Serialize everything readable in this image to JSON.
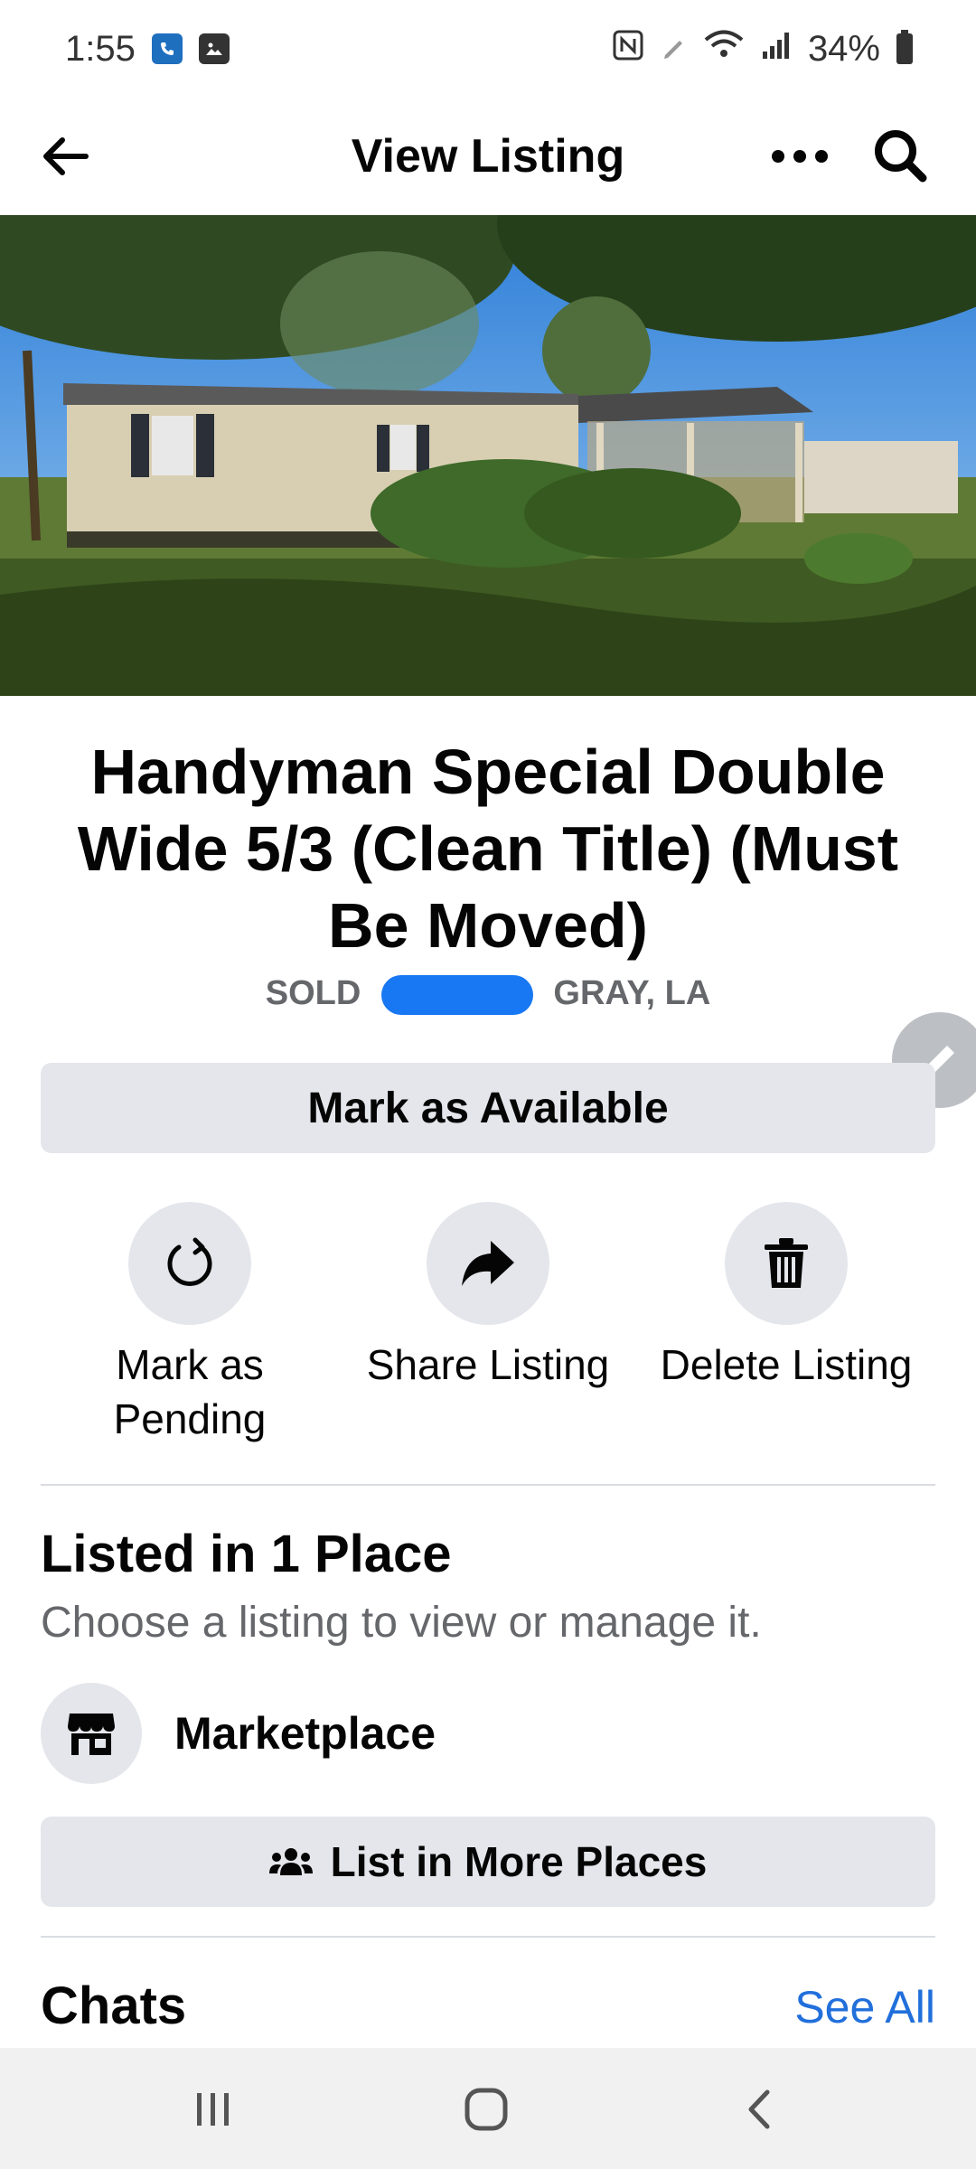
{
  "status_bar": {
    "time": "1:55",
    "battery": "34%",
    "icons": [
      "phone-app-icon",
      "gallery-icon",
      "nfc-icon",
      "pen-icon",
      "wifi-icon",
      "signal-icon",
      "battery-icon"
    ]
  },
  "app_bar": {
    "title": "View Listing",
    "icons": [
      "arrow-left-icon",
      "more-horizontal-icon",
      "search-icon"
    ]
  },
  "listing": {
    "title": "Handyman Special Double Wide 5/3 (Clean Title) (Must Be Moved)",
    "status": "SOLD",
    "location": "GRAY, LA",
    "primary_action": "Mark as Available"
  },
  "actions": [
    {
      "label": "Mark as Pending",
      "icon": "refresh-icon"
    },
    {
      "label": "Share Listing",
      "icon": "share-icon"
    },
    {
      "label": "Delete Listing",
      "icon": "trash-icon"
    }
  ],
  "places": {
    "title": "Listed in 1 Place",
    "subtitle": "Choose a listing to view or manage it.",
    "items": [
      {
        "label": "Marketplace",
        "icon": "storefront-icon"
      }
    ],
    "button": "List in More Places",
    "button_icon": "people-icon"
  },
  "chats": {
    "title": "Chats",
    "see_all": "See All"
  },
  "colors": {
    "accent": "#216fdb",
    "button_bg": "#e4e6eb",
    "secondary_text": "#65676b"
  },
  "nav_bar": {
    "icons": [
      "recent-apps-icon",
      "home-icon",
      "back-icon"
    ]
  }
}
